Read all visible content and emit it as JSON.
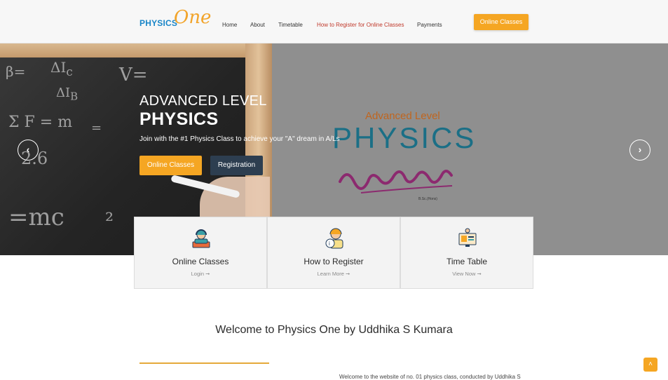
{
  "header": {
    "logo": {
      "word": "PHYSICS",
      "script": "One"
    },
    "nav": [
      {
        "label": "Home",
        "active": false
      },
      {
        "label": "About",
        "active": false
      },
      {
        "label": "Timetable",
        "active": false
      },
      {
        "label": "How to Register for Online Classes",
        "active": true
      },
      {
        "label": "Payments",
        "active": false
      }
    ],
    "cta_label": "Online Classes"
  },
  "hero": {
    "title_line1": "ADVANCED LEVEL",
    "title_line2": "PHYSICS",
    "subtitle": "Join with the #1 Physics Class to achieve your \"A\" dream in A/Ls",
    "primary_button": "Online Classes",
    "secondary_button": "Registration",
    "prev_icon": "chevron-left-icon",
    "next_icon": "chevron-right-icon",
    "poster": {
      "subtitle": "Advanced Level",
      "title": "PHYSICS",
      "degree": "B.Sc.(Hons)"
    }
  },
  "cards": [
    {
      "title": "Online Classes",
      "link": "Login ➞",
      "icon": "online-student-icon"
    },
    {
      "title": "How to Register",
      "link": "Learn More ➞",
      "icon": "register-info-icon"
    },
    {
      "title": "Time Table",
      "link": "View Now ➞",
      "icon": "timetable-screen-icon"
    }
  ],
  "welcome": {
    "heading": "Welcome to Physics One by Uddhika S Kumara",
    "intro": "Welcome to the website of no. 01 physics class, conducted by Uddhika S"
  },
  "colors": {
    "accent": "#f5a623",
    "dark_button": "#2d3e50",
    "active_nav": "#c0392b"
  },
  "scroll_top_icon": "chevron-up-icon"
}
